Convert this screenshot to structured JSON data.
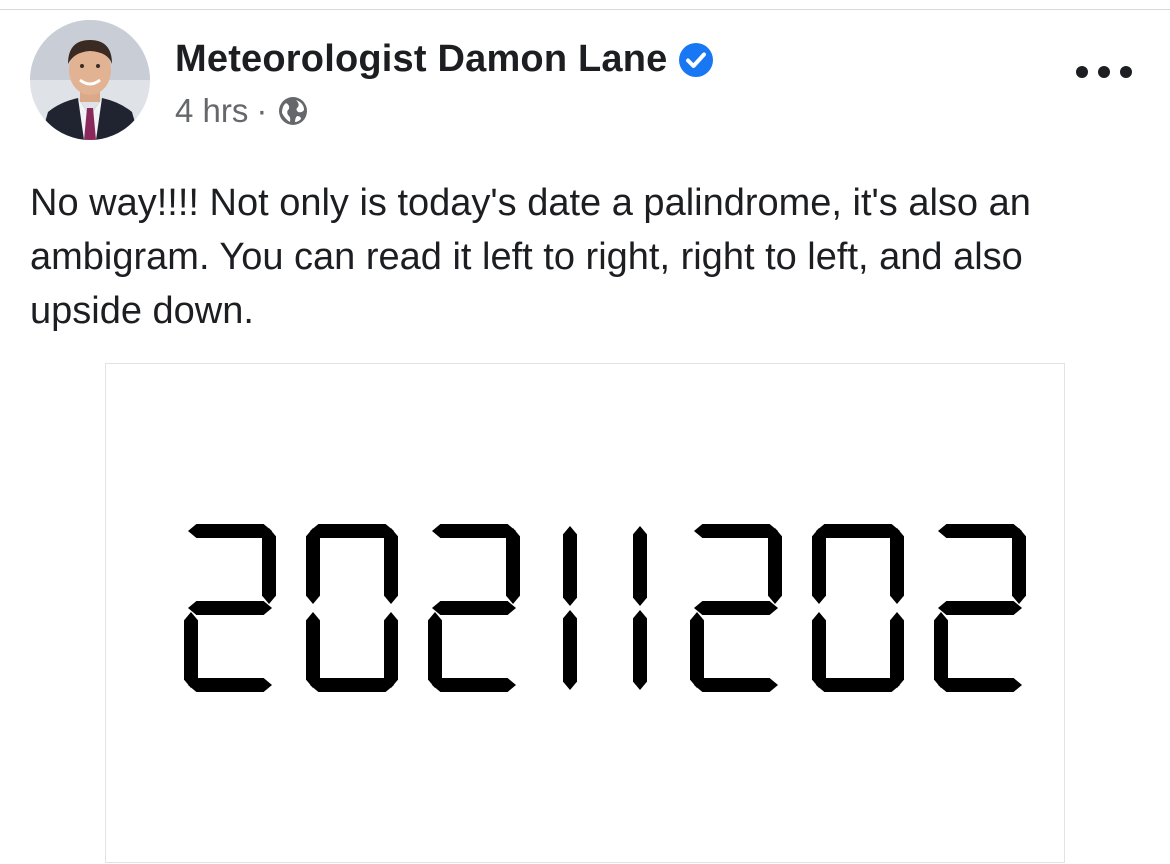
{
  "post": {
    "author_name": "Meteorologist Damon Lane",
    "verified_icon": "verified-badge-icon",
    "timestamp": "4 hrs",
    "separator": "·",
    "audience_icon": "globe-icon",
    "more_options_icon": "more-options-icon",
    "text": "No way!!!! Not only is today's date a palindrome, it's also an ambigram. You can read it left to right, right to left, and also upside down.",
    "image": {
      "display_text": "20211202",
      "style": "seven-segment digital display"
    }
  },
  "colors": {
    "verified_blue": "#1877f2",
    "meta_gray": "#65676b",
    "text": "#1c1e21"
  }
}
